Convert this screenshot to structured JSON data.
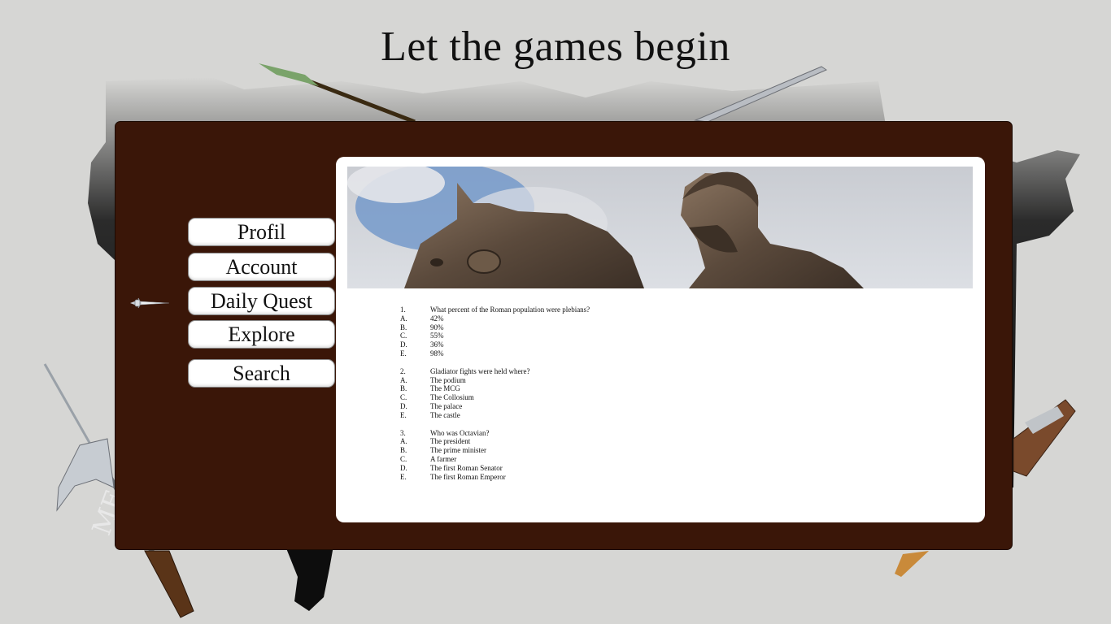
{
  "header": {
    "title": "Let the games begin"
  },
  "nav": {
    "items": [
      {
        "key": "profil",
        "label": "Profil"
      },
      {
        "key": "account",
        "label": "Account"
      },
      {
        "key": "daily_quest",
        "label": "Daily Quest"
      },
      {
        "key": "explore",
        "label": "Explore"
      },
      {
        "key": "search",
        "label": "Search"
      }
    ]
  },
  "quiz": {
    "questions": [
      {
        "number": "1.",
        "text": "What percent of the Roman population were plebians?",
        "options": [
          {
            "letter": "A.",
            "text": "42%"
          },
          {
            "letter": "B.",
            "text": "90%"
          },
          {
            "letter": "C.",
            "text": "55%"
          },
          {
            "letter": "D.",
            "text": "36%"
          },
          {
            "letter": "E.",
            "text": "98%"
          }
        ]
      },
      {
        "number": "2.",
        "text": "Gladiator fights were held where?",
        "options": [
          {
            "letter": "A.",
            "text": "The podium"
          },
          {
            "letter": "B.",
            "text": "The MCG"
          },
          {
            "letter": "C.",
            "text": "The Collosium"
          },
          {
            "letter": "D.",
            "text": "The palace"
          },
          {
            "letter": "E.",
            "text": "The castle"
          }
        ]
      },
      {
        "number": "3.",
        "text": "Who was Octavian?",
        "options": [
          {
            "letter": "A.",
            "text": "The president"
          },
          {
            "letter": "B.",
            "text": "The prime minister"
          },
          {
            "letter": "C.",
            "text": "A farmer"
          },
          {
            "letter": "D.",
            "text": "The first Roman Senator"
          },
          {
            "letter": "E.",
            "text": "The first Roman Emperor"
          }
        ]
      }
    ]
  },
  "icons": {
    "dagger": "dagger-icon",
    "spear": "spear-icon",
    "sword": "sword-icon",
    "halberd": "halberd-icon",
    "club": "club-icon"
  },
  "colors": {
    "background": "#d6d6d4",
    "panel": "#3a1608",
    "map": "#0d0d0d",
    "card": "#ffffff",
    "text": "#111111"
  }
}
